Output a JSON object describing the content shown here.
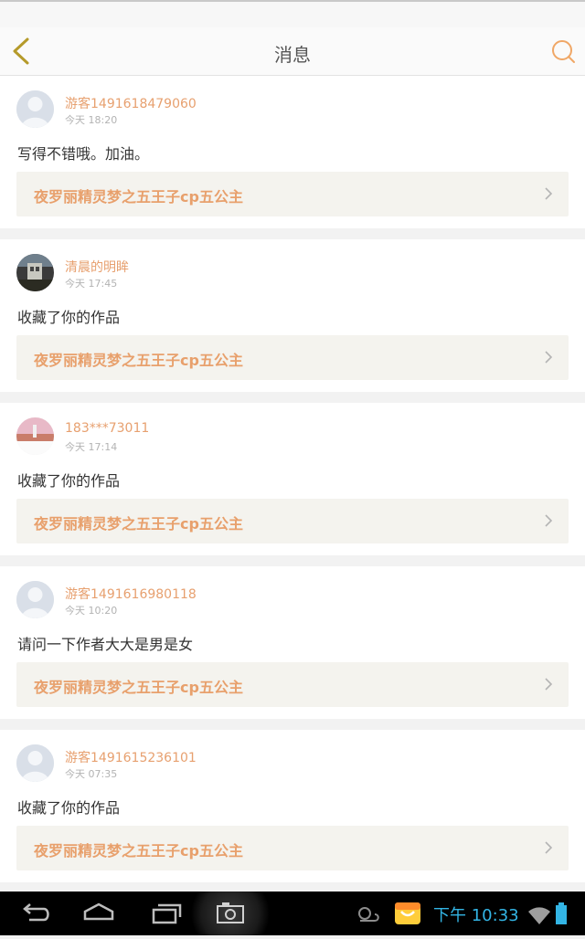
{
  "header": {
    "title": "消息"
  },
  "items": [
    {
      "username": "游客1491618479060",
      "time": "今天 18:20",
      "message": "写得不错哦。加油。",
      "work": "夜罗丽精灵梦之五王子cp五公主",
      "avatar": "default"
    },
    {
      "username": "清晨的明眸",
      "time": "今天 17:45",
      "message": "收藏了你的作品",
      "work": "夜罗丽精灵梦之五王子cp五公主",
      "avatar": "photo-dark"
    },
    {
      "username": "183***73011",
      "time": "今天 17:14",
      "message": "收藏了你的作品",
      "work": "夜罗丽精灵梦之五王子cp五公主",
      "avatar": "photo-sunset"
    },
    {
      "username": "游客1491616980118",
      "time": "今天 10:20",
      "message": "请问一下作者大大是男是女",
      "work": "夜罗丽精灵梦之五王子cp五公主",
      "avatar": "default"
    },
    {
      "username": "游客1491615236101",
      "time": "今天 07:35",
      "message": "收藏了你的作品",
      "work": "夜罗丽精灵梦之五王子cp五公主",
      "avatar": "default"
    }
  ],
  "system_bar": {
    "clock": "下午 10:33"
  },
  "colors": {
    "accent": "#e8a06c",
    "clock": "#33b5e5"
  }
}
